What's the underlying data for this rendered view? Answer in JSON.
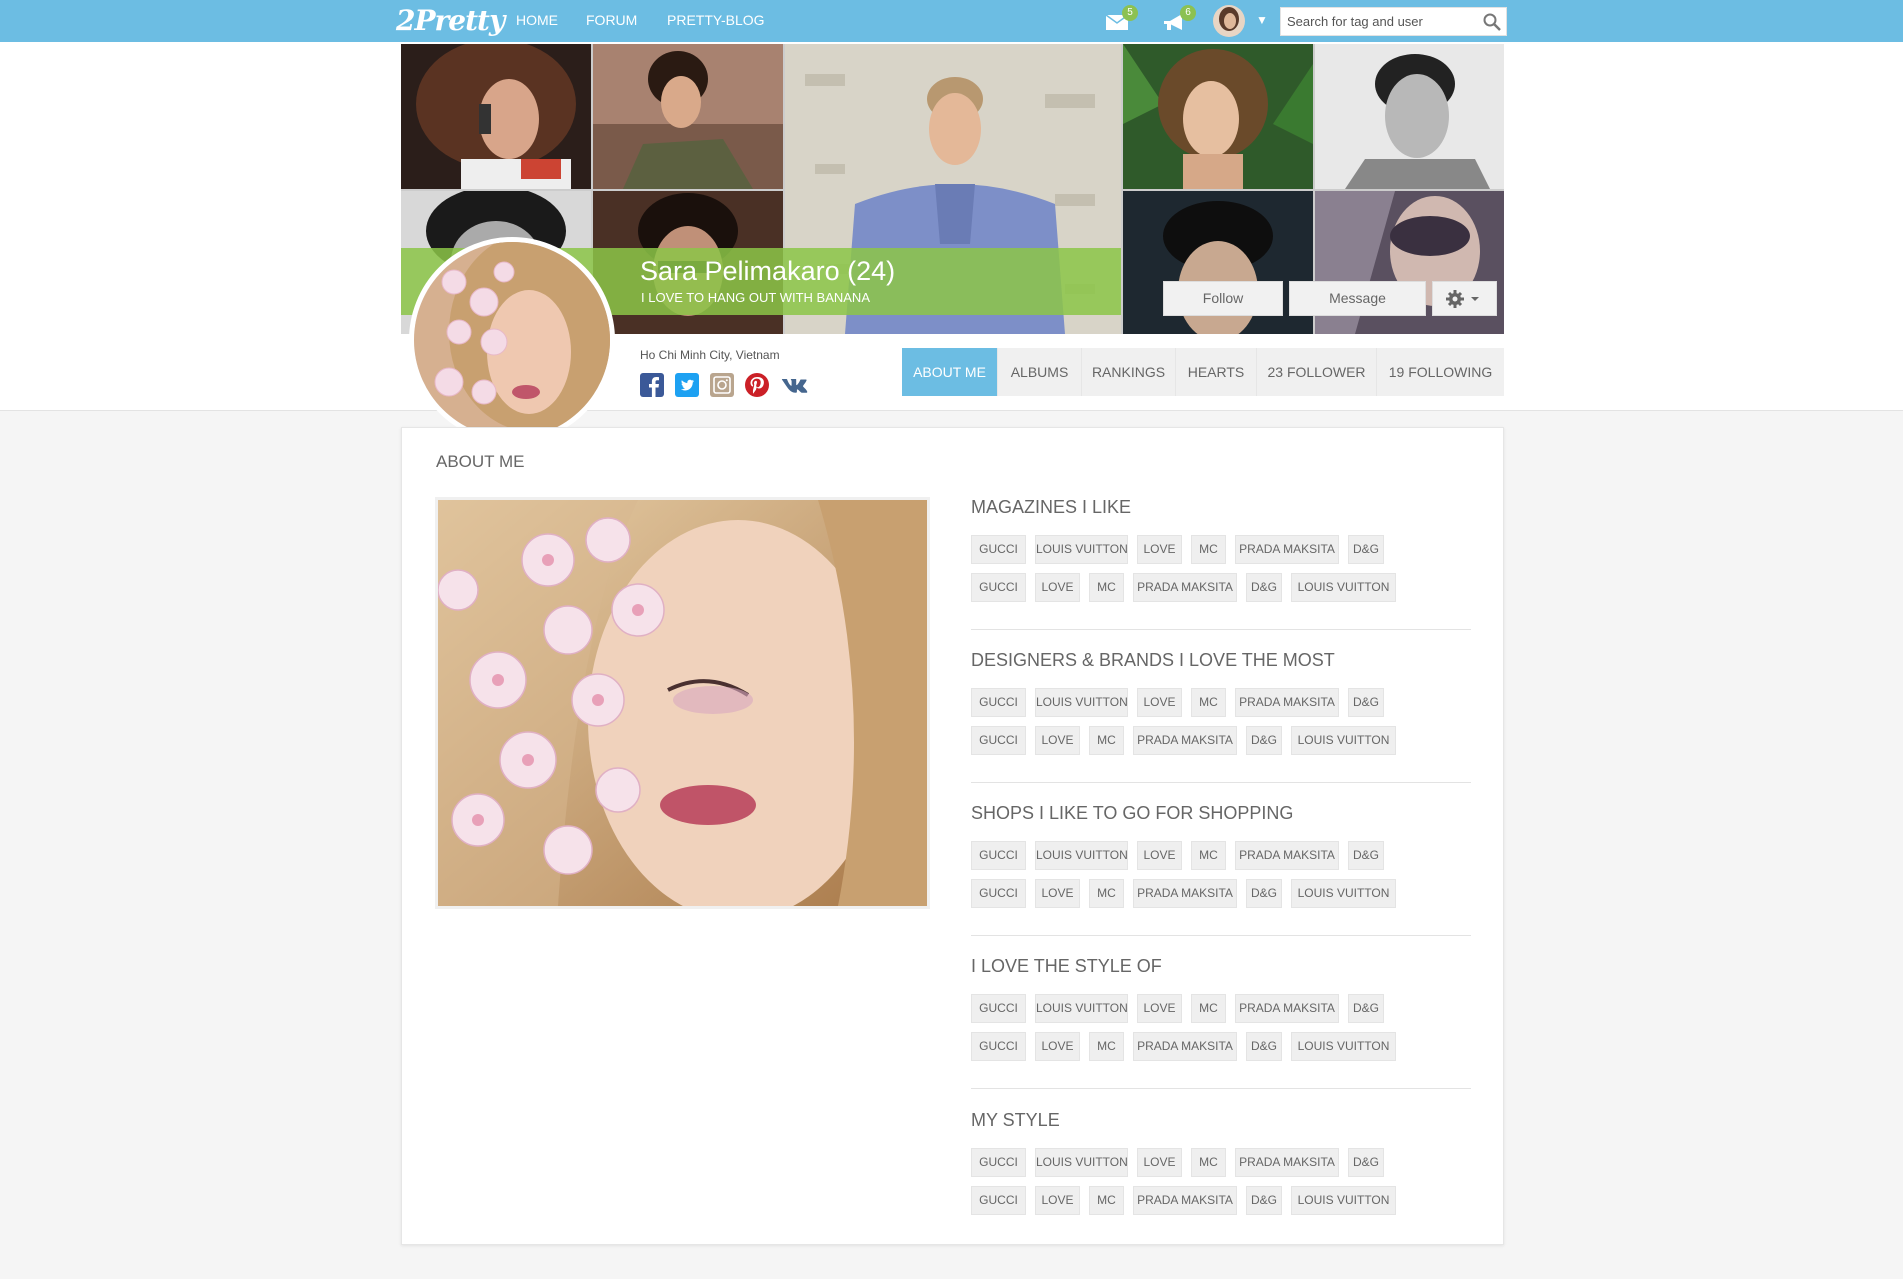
{
  "nav": {
    "logo": "2Pretty",
    "links": [
      "HOME",
      "FORUM",
      "PRETTY-BLOG"
    ],
    "mail_badge": "5",
    "notify_badge": "6",
    "search_placeholder": "Search for tag and user"
  },
  "profile": {
    "name": "Sara Pelimakaro (24)",
    "tagline": "I LOVE TO HANG OUT WITH BANANA",
    "location": "Ho Chi Minh City, Vietnam",
    "follow_label": "Follow",
    "message_label": "Message",
    "social_icons": [
      "facebook-icon",
      "twitter-icon",
      "instagram-icon",
      "pinterest-icon",
      "vk-icon"
    ]
  },
  "tabs": [
    {
      "label": "ABOUT ME",
      "active": true
    },
    {
      "label": "ALBUMS",
      "active": false
    },
    {
      "label": "RANKINGS",
      "active": false
    },
    {
      "label": "HEARTS",
      "active": false
    },
    {
      "label": "23 FOLLOWER",
      "active": false
    },
    {
      "label": "19 FOLLOWING",
      "active": false
    }
  ],
  "about": {
    "title": "ABOUT ME",
    "groups": [
      {
        "title": "MAGAZINES I LIKE",
        "row1": [
          "GUCCI",
          "LOUIS VUITTON",
          "LOVE",
          "MC",
          "PRADA MAKSITA",
          "D&G"
        ],
        "row2": [
          "GUCCI",
          "LOVE",
          "MC",
          "PRADA MAKSITA",
          "D&G",
          "LOUIS VUITTON"
        ]
      },
      {
        "title": "DESIGNERS & BRANDS I LOVE THE MOST",
        "row1": [
          "GUCCI",
          "LOUIS VUITTON",
          "LOVE",
          "MC",
          "PRADA MAKSITA",
          "D&G"
        ],
        "row2": [
          "GUCCI",
          "LOVE",
          "MC",
          "PRADA MAKSITA",
          "D&G",
          "LOUIS VUITTON"
        ]
      },
      {
        "title": "SHOPS I LIKE TO GO FOR SHOPPING",
        "row1": [
          "GUCCI",
          "LOUIS VUITTON",
          "LOVE",
          "MC",
          "PRADA MAKSITA",
          "D&G"
        ],
        "row2": [
          "GUCCI",
          "LOVE",
          "MC",
          "PRADA MAKSITA",
          "D&G",
          "LOUIS VUITTON"
        ]
      },
      {
        "title": "I LOVE THE STYLE OF",
        "row1": [
          "GUCCI",
          "LOUIS VUITTON",
          "LOVE",
          "MC",
          "PRADA MAKSITA",
          "D&G"
        ],
        "row2": [
          "GUCCI",
          "LOVE",
          "MC",
          "PRADA MAKSITA",
          "D&G",
          "LOUIS VUITTON"
        ]
      },
      {
        "title": "MY STYLE",
        "row1": [
          "GUCCI",
          "LOUIS VUITTON",
          "LOVE",
          "MC",
          "PRADA MAKSITA",
          "D&G"
        ],
        "row2": [
          "GUCCI",
          "LOVE",
          "MC",
          "PRADA MAKSITA",
          "D&G",
          "LOUIS VUITTON"
        ]
      }
    ]
  },
  "colors": {
    "brand_blue": "#6cbde3",
    "name_band_green": "#8cc648",
    "badge_green": "#8cc152"
  }
}
